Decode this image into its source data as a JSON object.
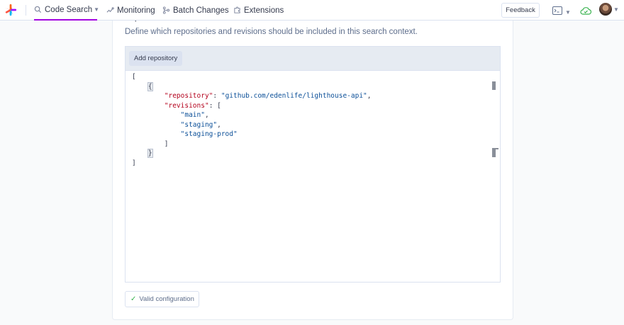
{
  "nav": {
    "items": [
      {
        "label": "Code Search",
        "icon": "search-icon",
        "active": true,
        "has_caret": true
      },
      {
        "label": "Monitoring",
        "icon": "monitoring-icon",
        "active": false
      },
      {
        "label": "Batch Changes",
        "icon": "batch-changes-icon",
        "active": false
      },
      {
        "label": "Extensions",
        "icon": "puzzle-icon",
        "active": false
      }
    ],
    "feedback_label": "Feedback",
    "accent_color": "#a305e1"
  },
  "section": {
    "heading": "Repositories and revisions",
    "description": "Define which repositories and revisions should be included in this search context."
  },
  "editor": {
    "add_repository_label": "Add repository",
    "lines": [
      {
        "indent": "",
        "parts": [
          {
            "t": "p",
            "v": "["
          }
        ]
      },
      {
        "indent": "    ",
        "parts": [
          {
            "t": "b",
            "v": "{"
          }
        ]
      },
      {
        "indent": "        ",
        "parts": [
          {
            "t": "k",
            "v": "\"repository\""
          },
          {
            "t": "p",
            "v": ": "
          },
          {
            "t": "s",
            "v": "\"github.com/edenlife/lighthouse-api\""
          },
          {
            "t": "p",
            "v": ","
          }
        ]
      },
      {
        "indent": "        ",
        "parts": [
          {
            "t": "k",
            "v": "\"revisions\""
          },
          {
            "t": "p",
            "v": ": ["
          }
        ]
      },
      {
        "indent": "            ",
        "parts": [
          {
            "t": "s",
            "v": "\"main\""
          },
          {
            "t": "p",
            "v": ","
          }
        ]
      },
      {
        "indent": "            ",
        "parts": [
          {
            "t": "s",
            "v": "\"staging\""
          },
          {
            "t": "p",
            "v": ","
          }
        ]
      },
      {
        "indent": "            ",
        "parts": [
          {
            "t": "s",
            "v": "\"staging-prod\""
          }
        ]
      },
      {
        "indent": "        ",
        "parts": [
          {
            "t": "p",
            "v": "]"
          }
        ]
      },
      {
        "indent": "    ",
        "parts": [
          {
            "t": "b",
            "v": "}"
          }
        ]
      },
      {
        "indent": "",
        "parts": [
          {
            "t": "p",
            "v": "]"
          }
        ]
      }
    ]
  },
  "status": {
    "valid_label": "Valid configuration",
    "valid_color": "#37b24d"
  }
}
